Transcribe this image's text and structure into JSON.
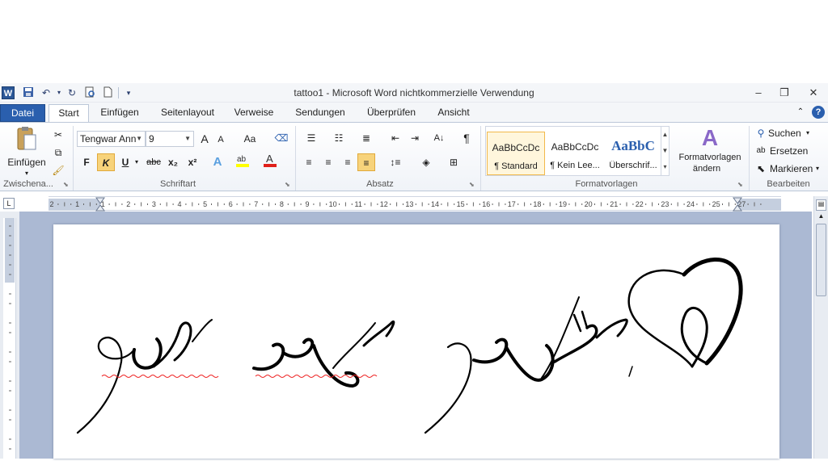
{
  "window": {
    "title": "tattoo1  -  Microsoft Word nichtkommerzielle Verwendung",
    "app_icon": "W",
    "controls": [
      "–",
      "❐",
      "✕"
    ]
  },
  "tabs": [
    "Datei",
    "Start",
    "Einfügen",
    "Seitenlayout",
    "Verweise",
    "Sendungen",
    "Überprüfen",
    "Ansicht"
  ],
  "active_tab": "Start",
  "ribbon": {
    "clipboard": {
      "paste_label": "Einfügen",
      "group_label": "Zwischena..."
    },
    "font": {
      "font_name": "Tengwar Ann",
      "font_size": "9",
      "bold": "F",
      "italic": "K",
      "underline": "U",
      "strike": "abc",
      "subscript": "x₂",
      "superscript": "x²",
      "change_case": "Aa",
      "grow": "A",
      "shrink": "A",
      "group_label": "Schriftart"
    },
    "paragraph": {
      "pilcrow": "¶",
      "group_label": "Absatz"
    },
    "styles": {
      "items": [
        {
          "sample": "AaBbCcDc",
          "name": "¶ Standard"
        },
        {
          "sample": "AaBbCcDc",
          "name": "¶ Kein Lee..."
        },
        {
          "sample": "AaBbC",
          "name": "Überschrif..."
        }
      ],
      "change_styles_line1": "Formatvorlagen",
      "change_styles_line2": "ändern",
      "group_label": "Formatvorlagen"
    },
    "editing": {
      "find": "Suchen",
      "replace": "Ersetzen",
      "select": "Markieren",
      "group_label": "Bearbeiten"
    }
  },
  "ruler": {
    "labels": [
      "2",
      "1",
      "1",
      "2",
      "3",
      "4",
      "5",
      "6",
      "7",
      "8",
      "9",
      "10",
      "11",
      "12",
      "13",
      "14",
      "15",
      "16",
      "17",
      "18",
      "19",
      "20",
      "21",
      "22",
      "23",
      "24",
      "25",
      "27"
    ]
  },
  "colors": {
    "file_tab": "#2a5fae",
    "doc_background": "#abb9d3",
    "highlight": "#f2b94b"
  }
}
